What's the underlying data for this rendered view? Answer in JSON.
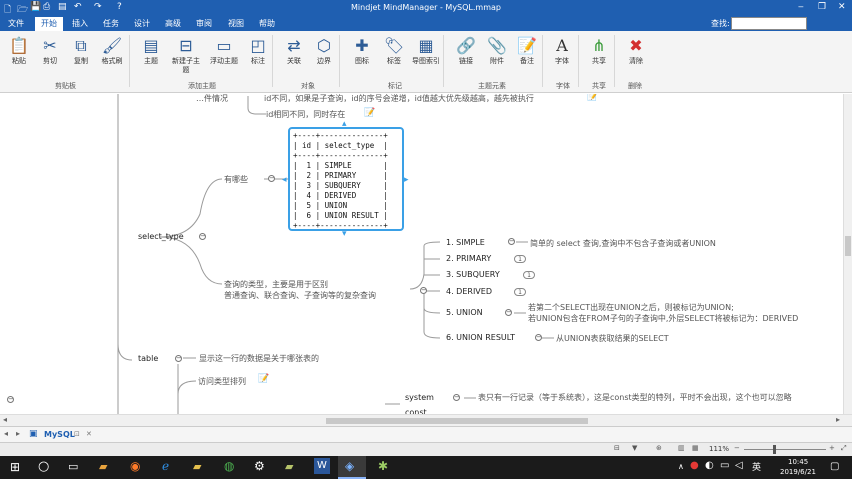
{
  "titlebar": {
    "title": "Mindjet MindManager - MySQL.mmap",
    "bg": "#1f5fb1",
    "min": "‒",
    "restore": "❐",
    "close": "✕"
  },
  "menu": {
    "tabs": [
      "文件",
      "开始",
      "插入",
      "任务",
      "设计",
      "高级",
      "审阅",
      "视图",
      "帮助"
    ],
    "active": "开始",
    "find_label": "查找:"
  },
  "ribbon": {
    "buttons": [
      {
        "label": "粘贴",
        "icon": "paste-icon",
        "glyph": "📋"
      },
      {
        "label": "剪切",
        "icon": "cut-icon",
        "glyph": "✂"
      },
      {
        "label": "复制",
        "icon": "copy-icon",
        "glyph": "⧉"
      },
      {
        "label": "格式刷",
        "icon": "format-painter-icon",
        "glyph": "🖌"
      },
      {
        "label": "主题",
        "icon": "topic-icon",
        "glyph": "▤"
      },
      {
        "label": "新建子主题",
        "icon": "subtopic-icon",
        "glyph": "⊟"
      },
      {
        "label": "浮动主题",
        "icon": "floating-topic-icon",
        "glyph": "▭"
      },
      {
        "label": "标注",
        "icon": "callout-icon",
        "glyph": "◰"
      },
      {
        "label": "关联",
        "icon": "relationship-icon",
        "glyph": "⇄"
      },
      {
        "label": "边界",
        "icon": "boundary-icon",
        "glyph": "⬡"
      },
      {
        "label": "图标",
        "icon": "icon-icon",
        "glyph": "✚"
      },
      {
        "label": "标签",
        "icon": "tag-icon",
        "glyph": "🏷"
      },
      {
        "label": "导图索引",
        "icon": "map-index-icon",
        "glyph": "▦"
      },
      {
        "label": "链接",
        "icon": "link-icon",
        "glyph": "🔗"
      },
      {
        "label": "附件",
        "icon": "attachment-icon",
        "glyph": "📎"
      },
      {
        "label": "备注",
        "icon": "notes-icon",
        "glyph": "📝"
      },
      {
        "label": "字体",
        "icon": "font-icon",
        "glyph": "A"
      },
      {
        "label": "共享",
        "icon": "share-icon",
        "glyph": "⋔"
      },
      {
        "label": "清除",
        "icon": "clear-icon",
        "glyph": "✖"
      }
    ],
    "groups": [
      "剪贴板",
      "添加主题",
      "对象",
      "标记",
      "主题元素",
      "字体",
      "共享",
      "删除"
    ]
  },
  "map": {
    "top_fragment": "…件情况",
    "top_right_fragment": "id不同，如果是子查询，id的序号会递增，id值越大优先级越高，越先被执行",
    "id_diff": "id相同不同，同时存在",
    "select_type": "select_type",
    "which": "有哪些",
    "table_header": "| id | select_type  |",
    "table_rows": [
      {
        "id": "1",
        "type": "SIMPLE"
      },
      {
        "id": "2",
        "type": "PRIMARY"
      },
      {
        "id": "3",
        "type": "SUBQUERY"
      },
      {
        "id": "4",
        "type": "DERIVED"
      },
      {
        "id": "5",
        "type": "UNION"
      },
      {
        "id": "6",
        "type": "UNION RESULT"
      }
    ],
    "desc_line1": "查询的类型，主要是用于区别",
    "desc_line2": "普通查询、联合查询、子查询等的复杂查询",
    "types": [
      {
        "label": "1. SIMPLE",
        "note": "简单的 select 查询,查询中不包含子查询或者UNION"
      },
      {
        "label": "2. PRIMARY",
        "badge": "1"
      },
      {
        "label": "3. SUBQUERY",
        "badge": "1"
      },
      {
        "label": "4. DERIVED",
        "badge": "1"
      },
      {
        "label": "5. UNION",
        "note1": "若第二个SELECT出现在UNION之后，则被标记为UNION;",
        "note2": "若UNION包含在FROM子句的子查询中,外层SELECT将被标记为：DERIVED"
      },
      {
        "label": "6. UNION RESULT",
        "note": "从UNION表获取结果的SELECT"
      }
    ],
    "table": "table",
    "table_desc": "显示这一行的数据是关于哪张表的",
    "type_label": "访问类型排列",
    "system": "system",
    "system_desc": "表只有一行记录（等于系统表），这是const类型的特列，平时不会出现，这个也可以忽略",
    "const": "const"
  },
  "doc_tab": {
    "label": "MySQL",
    "pin": "⊡",
    "close": "✕"
  },
  "status": {
    "zoom": "111%"
  },
  "taskbar": {
    "time": "10:45",
    "date": "2019/6/21"
  }
}
